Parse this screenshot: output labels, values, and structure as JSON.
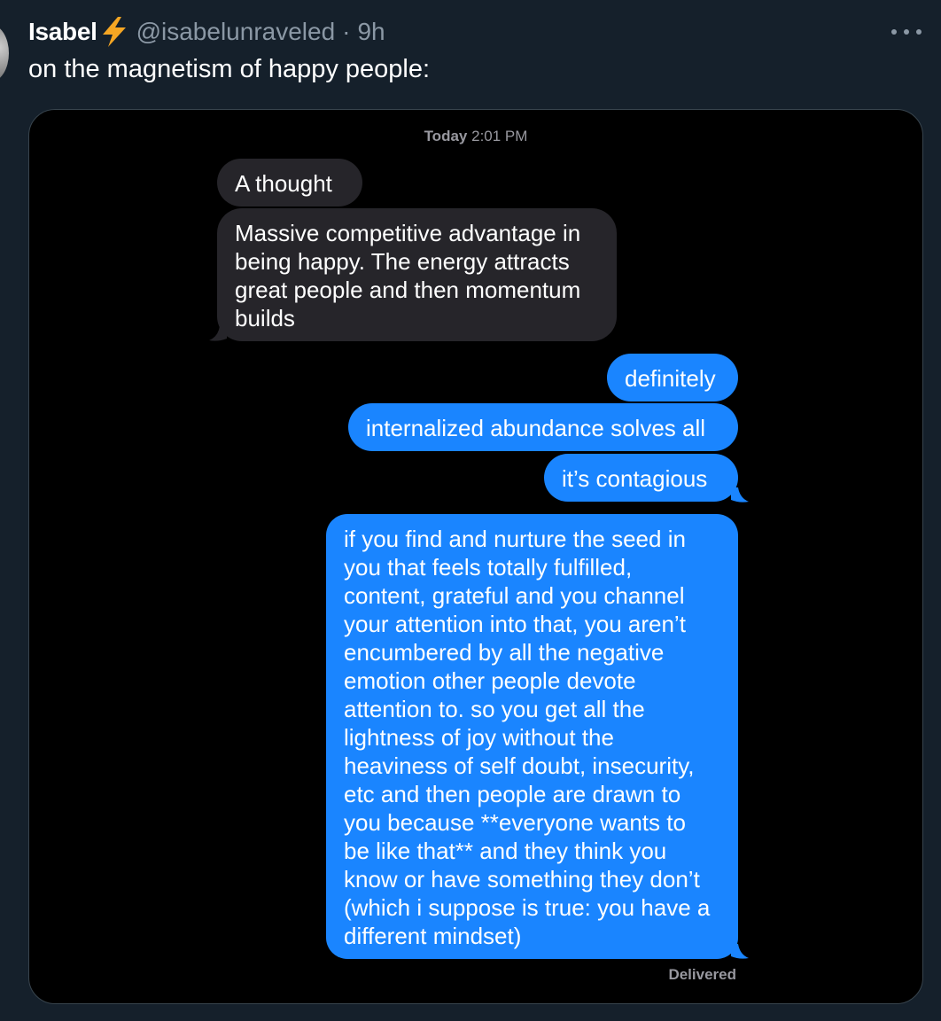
{
  "tweet": {
    "display_name": "Isabel",
    "handle": "@isabelunraveled",
    "separator": "·",
    "time": "9h",
    "text": "on the magnetism of happy people:",
    "verified_emoji_icon": "lightning-bolt-icon",
    "more_icon": "ellipsis-icon"
  },
  "imessage": {
    "timestamp_day": "Today",
    "timestamp_time": "2:01 PM",
    "incoming": [
      "A thought",
      "Massive competitive advantage in\nbeing happy. The energy attracts\ngreat people and then momentum\nbuilds"
    ],
    "outgoing": [
      "definitely",
      "internalized abundance solves all",
      "it’s contagious",
      "if you find and nurture the seed in\nyou that feels totally fulfilled,\ncontent, grateful and you channel\nyour attention into that, you aren’t\nencumbered by all the negative\nemotion other people devote\nattention to. so you get all the\nlightness of joy without the\nheaviness of self doubt, insecurity,\netc and then people are drawn to\nyou because **everyone wants to\nbe like that** and they think you\nknow or have something they don’t\n(which i suppose is true: you have a\ndifferent mindset)"
    ],
    "status": "Delivered"
  },
  "colors": {
    "background": "#15202b",
    "incoming_bubble": "#26252a",
    "outgoing_bubble": "#1a85ff",
    "secondary_text": "#8b98a5",
    "bolt": "#f5a623"
  }
}
